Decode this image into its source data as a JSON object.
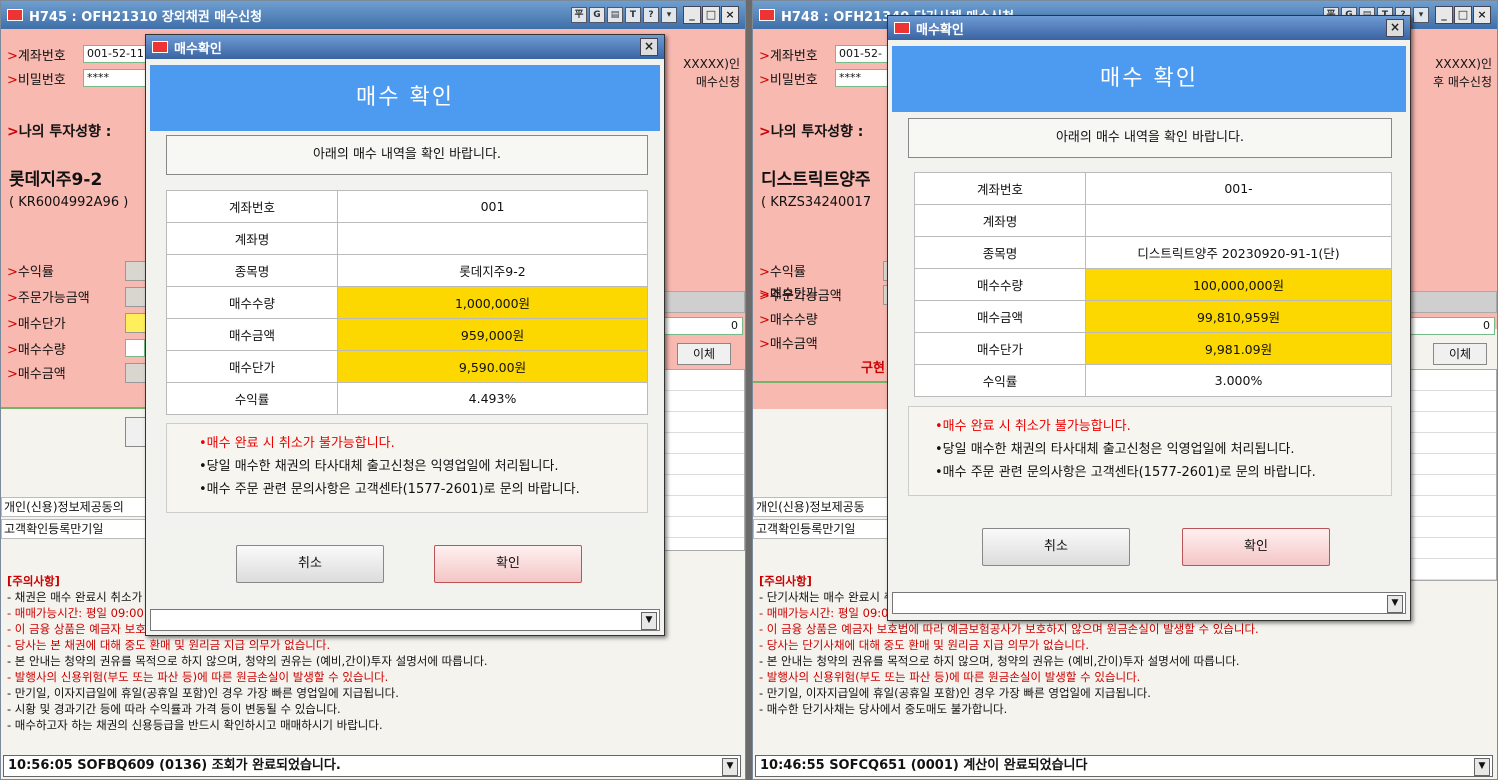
{
  "left": {
    "title": "H745 : OFH21310 장외채권 매수신청",
    "acct_label": "계좌번호",
    "acct_value": "001-52-11",
    "pw_label": "비밀번호",
    "pw_value": "****",
    "right_text1": "XXXXX)인",
    "right_text2": "매수신청",
    "invest_label": "나의 투자성향 :",
    "bond_name": "롯데지주9-2",
    "bond_code": "( KR6004992A96 )",
    "field_yield": "수익률",
    "field_orderable": "주문가능금액",
    "field_price": "매수단가",
    "field_qty": "매수수량",
    "field_amount": "매수금액",
    "zero": "0",
    "transfer_btn": "이체",
    "info1": "개인(신용)정보제공동의",
    "info2": "고객확인등록만기일",
    "cautions_head": "[주의사항]",
    "cautions": [
      {
        "t": "- 채권은 매수 완료시 취소가 불가능합니다.",
        "red": false
      },
      {
        "t": "- 매매가능시간: 평일 09:00 ~ 15:30 (토,일,공휴일 제외)",
        "red": true
      },
      {
        "t": "- 이 금융 상품은 예금자 보호법에 따라 예금보험공사가 보호하지 않으며 원금손실이 발생할 수 있습니다.",
        "red": true
      },
      {
        "t": "- 당사는 본 채권에 대해 중도 환매 및 원리금 지급 의무가 없습니다.",
        "red": true
      },
      {
        "t": "- 본 안내는 청약의 권유를 목적으로 하지 않으며, 청약의 권유는 (예비,간이)투자 설명서에 따릅니다.",
        "red": false
      },
      {
        "t": "- 발행사의 신용위험(부도 또는 파산 등)에 따른 원금손실이 발생할 수 있습니다.",
        "red": true
      },
      {
        "t": "- 만기일, 이자지급일에 휴일(공휴일 포함)인 경우 가장 빠른 영업일에 지급됩니다.",
        "red": false
      },
      {
        "t": "- 시황 및 경과기간 등에 따라 수익률과 가격 등이 변동될 수 있습니다.",
        "red": false
      },
      {
        "t": "- 매수하고자 하는 채권의 신용등급을 반드시 확인하시고 매매하시기 바랍니다.",
        "red": false
      }
    ],
    "status": "10:56:05 SOFBQ609 (0136) 조회가 완료되었습니다.",
    "dialog": {
      "title": "매수확인",
      "banner": "매수 확인",
      "notice": "아래의 매수 내역을 확인 바랍니다.",
      "rows": [
        {
          "k": "계좌번호",
          "v": "001",
          "y": false
        },
        {
          "k": "계좌명",
          "v": "",
          "y": false
        },
        {
          "k": "종목명",
          "v": "롯데지주9-2",
          "y": false
        },
        {
          "k": "매수수량",
          "v": "1,000,000원",
          "y": true
        },
        {
          "k": "매수금액",
          "v": "959,000원",
          "y": true
        },
        {
          "k": "매수단가",
          "v": "9,590.00원",
          "y": true
        },
        {
          "k": "수익률",
          "v": "4.493%",
          "y": false
        }
      ],
      "warn1": "•매수 완료 시 취소가 불가능합니다.",
      "warn2": "•당일 매수한 채권의 타사대체 출고신청은 익영업일에 처리됩니다.",
      "warn3": "•매수 주문 관련 문의사항은 고객센타(1577-2601)로 문의 바랍니다.",
      "cancel": "취소",
      "ok": "확인"
    }
  },
  "right": {
    "title": "H748 : OFH21340 단기사채 매수신청",
    "acct_label": "계좌번호",
    "acct_value": "001-52-",
    "pw_label": "비밀번호",
    "pw_value": "****",
    "right_text1": "XXXXX)인",
    "right_text2": "후 매수신청",
    "invest_label": "나의 투자성향 :",
    "bond_name": "디스트릭트양주",
    "bond_code": "( KRZS34240017",
    "field_yield": "수익률",
    "field_orderable": "주문가능금액",
    "field_price": "매수단가",
    "field_qty": "매수수량",
    "field_amount": "매수금액",
    "red_partial": "구현",
    "zero": "0",
    "transfer_btn": "이체",
    "info1": "개인(신용)정보제공동",
    "info2": "고객확인등록만기일",
    "cautions_head": "[주의사항]",
    "cautions": [
      {
        "t": "- 단기사채는 매수 완료시 취소가 불가능합니다.",
        "red": false
      },
      {
        "t": "- 매매가능시간: 평일 09:00 ~ 15:30 (토,일,공휴일 제외)",
        "red": true
      },
      {
        "t": "- 이 금융 상품은 예금자 보호법에 따라 예금보험공사가 보호하지 않으며 원금손실이 발생할 수 있습니다.",
        "red": true
      },
      {
        "t": "- 당사는 단기사채에 대해 중도 환매 및 원리금 지급 의무가 없습니다.",
        "red": true
      },
      {
        "t": "- 본 안내는 청약의 권유를 목적으로 하지 않으며, 청약의 권유는 (예비,간이)투자 설명서에 따릅니다.",
        "red": false
      },
      {
        "t": "- 발행사의 신용위험(부도 또는 파산 등)에 따른 원금손실이 발생할 수 있습니다.",
        "red": true
      },
      {
        "t": "- 만기일, 이자지급일에 휴일(공휴일 포함)인 경우 가장 빠른 영업일에 지급됩니다.",
        "red": false
      },
      {
        "t": "- 매수한 단기사채는 당사에서 중도매도 불가합니다.",
        "red": false
      }
    ],
    "status": "10:46:55 SOFCQ651 (0001) 계산이 완료되었습니다",
    "dialog": {
      "title": "매수확인",
      "banner": "매수 확인",
      "notice": "아래의 매수 내역을 확인 바랍니다.",
      "rows": [
        {
          "k": "계좌번호",
          "v": "001-",
          "y": false
        },
        {
          "k": "계좌명",
          "v": "",
          "y": false
        },
        {
          "k": "종목명",
          "v": "디스트릭트양주 20230920-91-1(단)",
          "y": false
        },
        {
          "k": "매수수량",
          "v": "100,000,000원",
          "y": true
        },
        {
          "k": "매수금액",
          "v": "99,810,959원",
          "y": true
        },
        {
          "k": "매수단가",
          "v": "9,981.09원",
          "y": true
        },
        {
          "k": "수익률",
          "v": "3.000%",
          "y": false
        }
      ],
      "warn1": "•매수 완료 시 취소가 불가능합니다.",
      "warn2": "•당일 매수한 채권의 타사대체 출고신청은 익영업일에 처리됩니다.",
      "warn3": "•매수 주문 관련 문의사항은 고객센타(1577-2601)로 문의 바랍니다.",
      "cancel": "취소",
      "ok": "확인"
    }
  },
  "icons": {
    "minimize": "_",
    "restore": "□",
    "close": "×",
    "dropdown": "▼",
    "arrow": ">"
  }
}
